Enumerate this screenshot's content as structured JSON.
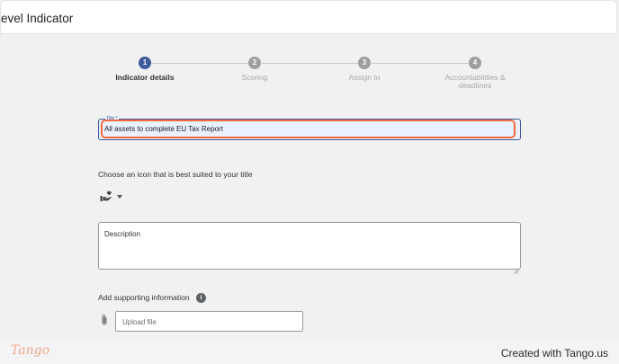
{
  "window": {
    "title": "evel Indicator"
  },
  "stepper": {
    "steps": [
      {
        "number": "1",
        "label": "Indicator details",
        "active": true
      },
      {
        "number": "2",
        "label": "Scoring",
        "active": false
      },
      {
        "number": "3",
        "label": "Assign to",
        "active": false
      },
      {
        "number": "4",
        "label": "Accountabilities &\ndeadlines",
        "active": false
      }
    ]
  },
  "form": {
    "title_label": "Title *",
    "title_value": "All assets to complete EU Tax Report",
    "icon_prompt": "Choose an icon that is best suited to your title",
    "selected_icon": "hand-heart-icon",
    "description_placeholder": "Description",
    "supporting_label": "Add supporting information",
    "info_icon": "i",
    "upload_placeholder": "Upload file"
  },
  "footer": {
    "brand": "Tango",
    "credit": "Created with Tango.us"
  },
  "colors": {
    "accent": "#3d5a9c",
    "highlight": "#f26b3a",
    "field_bg": "#e9f0fe"
  }
}
